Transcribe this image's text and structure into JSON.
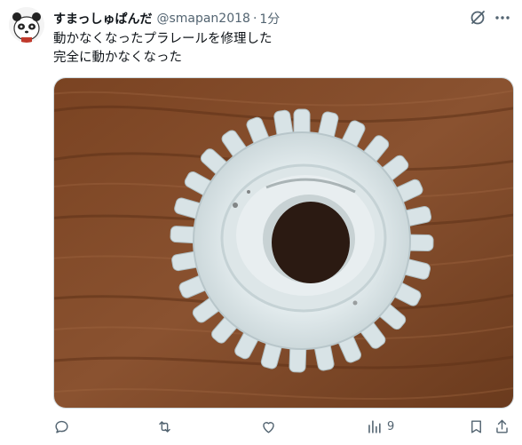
{
  "post": {
    "display_name": "すまっしゅぱんだ",
    "handle": "@smapan2018",
    "separator": "·",
    "time": "1分",
    "text_lines": [
      "動かなくなったプラレールを修理した",
      "完全に動かなくなった"
    ],
    "views_count": "9"
  },
  "icons": {
    "avatar": "panda-avatar",
    "grok": "grok-icon",
    "more": "more-icon",
    "reply": "reply-icon",
    "repost": "repost-icon",
    "like": "like-icon",
    "views": "views-icon",
    "bookmark": "bookmark-icon",
    "share": "share-icon"
  },
  "colors": {
    "text": "#0f1419",
    "muted": "#536471"
  }
}
